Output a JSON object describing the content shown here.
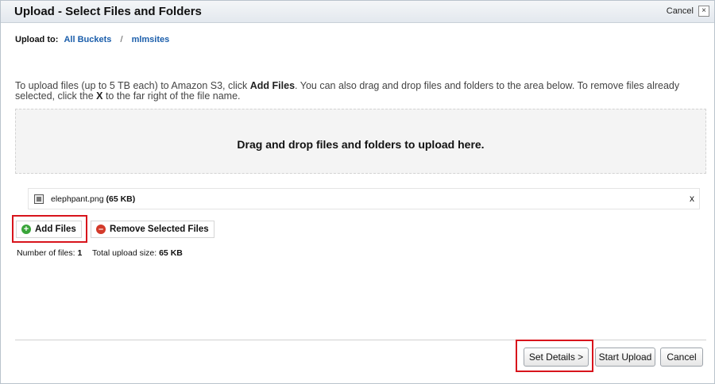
{
  "dialog": {
    "title": "Upload - Select Files and Folders",
    "title_cancel": "Cancel",
    "close_glyph": "×"
  },
  "upload_to": {
    "label": "Upload to:",
    "crumbs": [
      "All Buckets",
      "mlmsites"
    ],
    "separator": "/"
  },
  "instructions": {
    "part1": "To upload files (up to 5 TB each) to Amazon S3, click ",
    "bold1": "Add Files",
    "part2": ". You can also drag and drop files and folders to the area below. To remove files already selected, click the ",
    "bold2": "X",
    "part3": " to the far right of the file name."
  },
  "dropzone": {
    "text": "Drag and drop files and folders to upload here."
  },
  "files": [
    {
      "name": "elephpant.png",
      "size": "(65 KB)",
      "remove": "x",
      "icon": "image-file-icon"
    }
  ],
  "toolbar": {
    "add_files": "Add Files",
    "remove_selected": "Remove Selected Files",
    "add_icon_glyph": "+",
    "remove_icon_glyph": "–"
  },
  "summary": {
    "count_label": "Number of files:",
    "count_value": "1",
    "size_label": "Total upload size:",
    "size_value": "65 KB"
  },
  "footer": {
    "set_details": "Set Details >",
    "start_upload": "Start Upload",
    "cancel": "Cancel"
  },
  "colors": {
    "link": "#1b5eab",
    "highlight": "#d8141c",
    "add_icon": "#3aa53a",
    "remove_icon": "#d33a2a"
  }
}
